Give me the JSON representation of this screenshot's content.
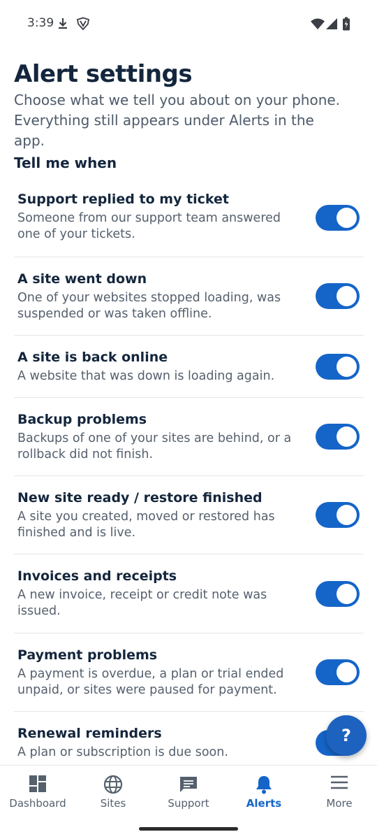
{
  "status_bar": {
    "time": "3:39",
    "icons": [
      "download-icon",
      "shield-icon",
      "wifi-icon",
      "cellular-icon",
      "battery-charging-icon"
    ]
  },
  "page": {
    "title": "Alert settings",
    "subtitle": "Choose what we tell you about on your phone. Everything still appears under Alerts in the app.",
    "section_label": "Tell me when"
  },
  "settings": [
    {
      "title": "Support replied to my ticket",
      "description": "Someone from our support team answered one of your tickets.",
      "enabled": true
    },
    {
      "title": "A site went down",
      "description": "One of your websites stopped loading, was suspended or was taken offline.",
      "enabled": true
    },
    {
      "title": "A site is back online",
      "description": "A website that was down is loading again.",
      "enabled": true
    },
    {
      "title": "Backup problems",
      "description": "Backups of one of your sites are behind, or a rollback did not finish.",
      "enabled": true
    },
    {
      "title": "New site ready / restore finished",
      "description": "A site you created, moved or restored has finished and is live.",
      "enabled": true
    },
    {
      "title": "Invoices and receipts",
      "description": "A new invoice, receipt or credit note was issued.",
      "enabled": true
    },
    {
      "title": "Payment problems",
      "description": "A payment is overdue, a plan or trial ended unpaid, or sites were paused for payment.",
      "enabled": true
    },
    {
      "title": "Renewal reminders",
      "description": "A plan or subscription is due soon.",
      "enabled": true
    }
  ],
  "help_button": {
    "label": "?"
  },
  "bottom_nav": {
    "items": [
      {
        "label": "Dashboard",
        "icon": "dashboard-icon"
      },
      {
        "label": "Sites",
        "icon": "globe-icon"
      },
      {
        "label": "Support",
        "icon": "chat-icon"
      },
      {
        "label": "Alerts",
        "icon": "bell-icon",
        "active": true
      },
      {
        "label": "More",
        "icon": "menu-icon"
      }
    ]
  },
  "colors": {
    "accent": "#1565c8",
    "title_text": "#14263d",
    "body_text": "#55606d"
  }
}
